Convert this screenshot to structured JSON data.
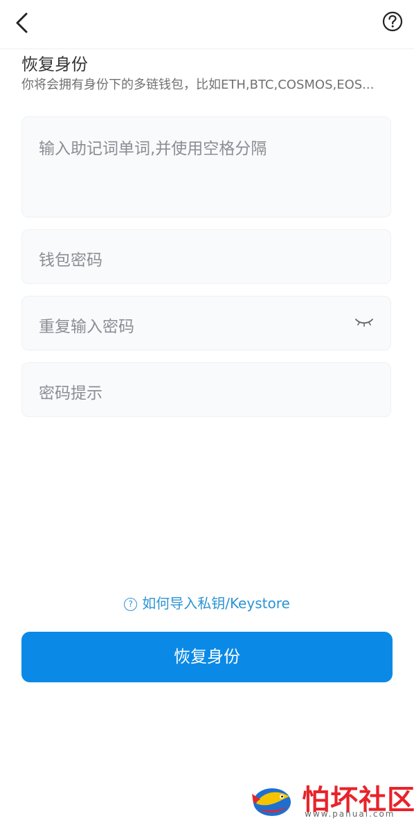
{
  "nav": {
    "back_icon": "chevron-left-icon",
    "help_icon": "question-circle-icon"
  },
  "header": {
    "title": "恢复身份",
    "subtitle": "你将会拥有身份下的多链钱包，比如ETH,BTC,COSMOS,EOS..."
  },
  "form": {
    "mnemonic_placeholder": "输入助记词单词,并使用空格分隔",
    "wallet_password_placeholder": "钱包密码",
    "repeat_password_placeholder": "重复输入密码",
    "password_hint_placeholder": "密码提示",
    "eye_icon": "eye-closed-icon"
  },
  "help_link": {
    "icon": "?",
    "label": "如何导入私钥/Keystore"
  },
  "primary_button": {
    "label": "恢复身份"
  },
  "watermark": {
    "text": "怕坏社区",
    "url": "www.pahuai.com"
  },
  "colors": {
    "accent": "#0a8ae6",
    "link": "#2c93d4",
    "watermark_red": "#e8232a"
  }
}
